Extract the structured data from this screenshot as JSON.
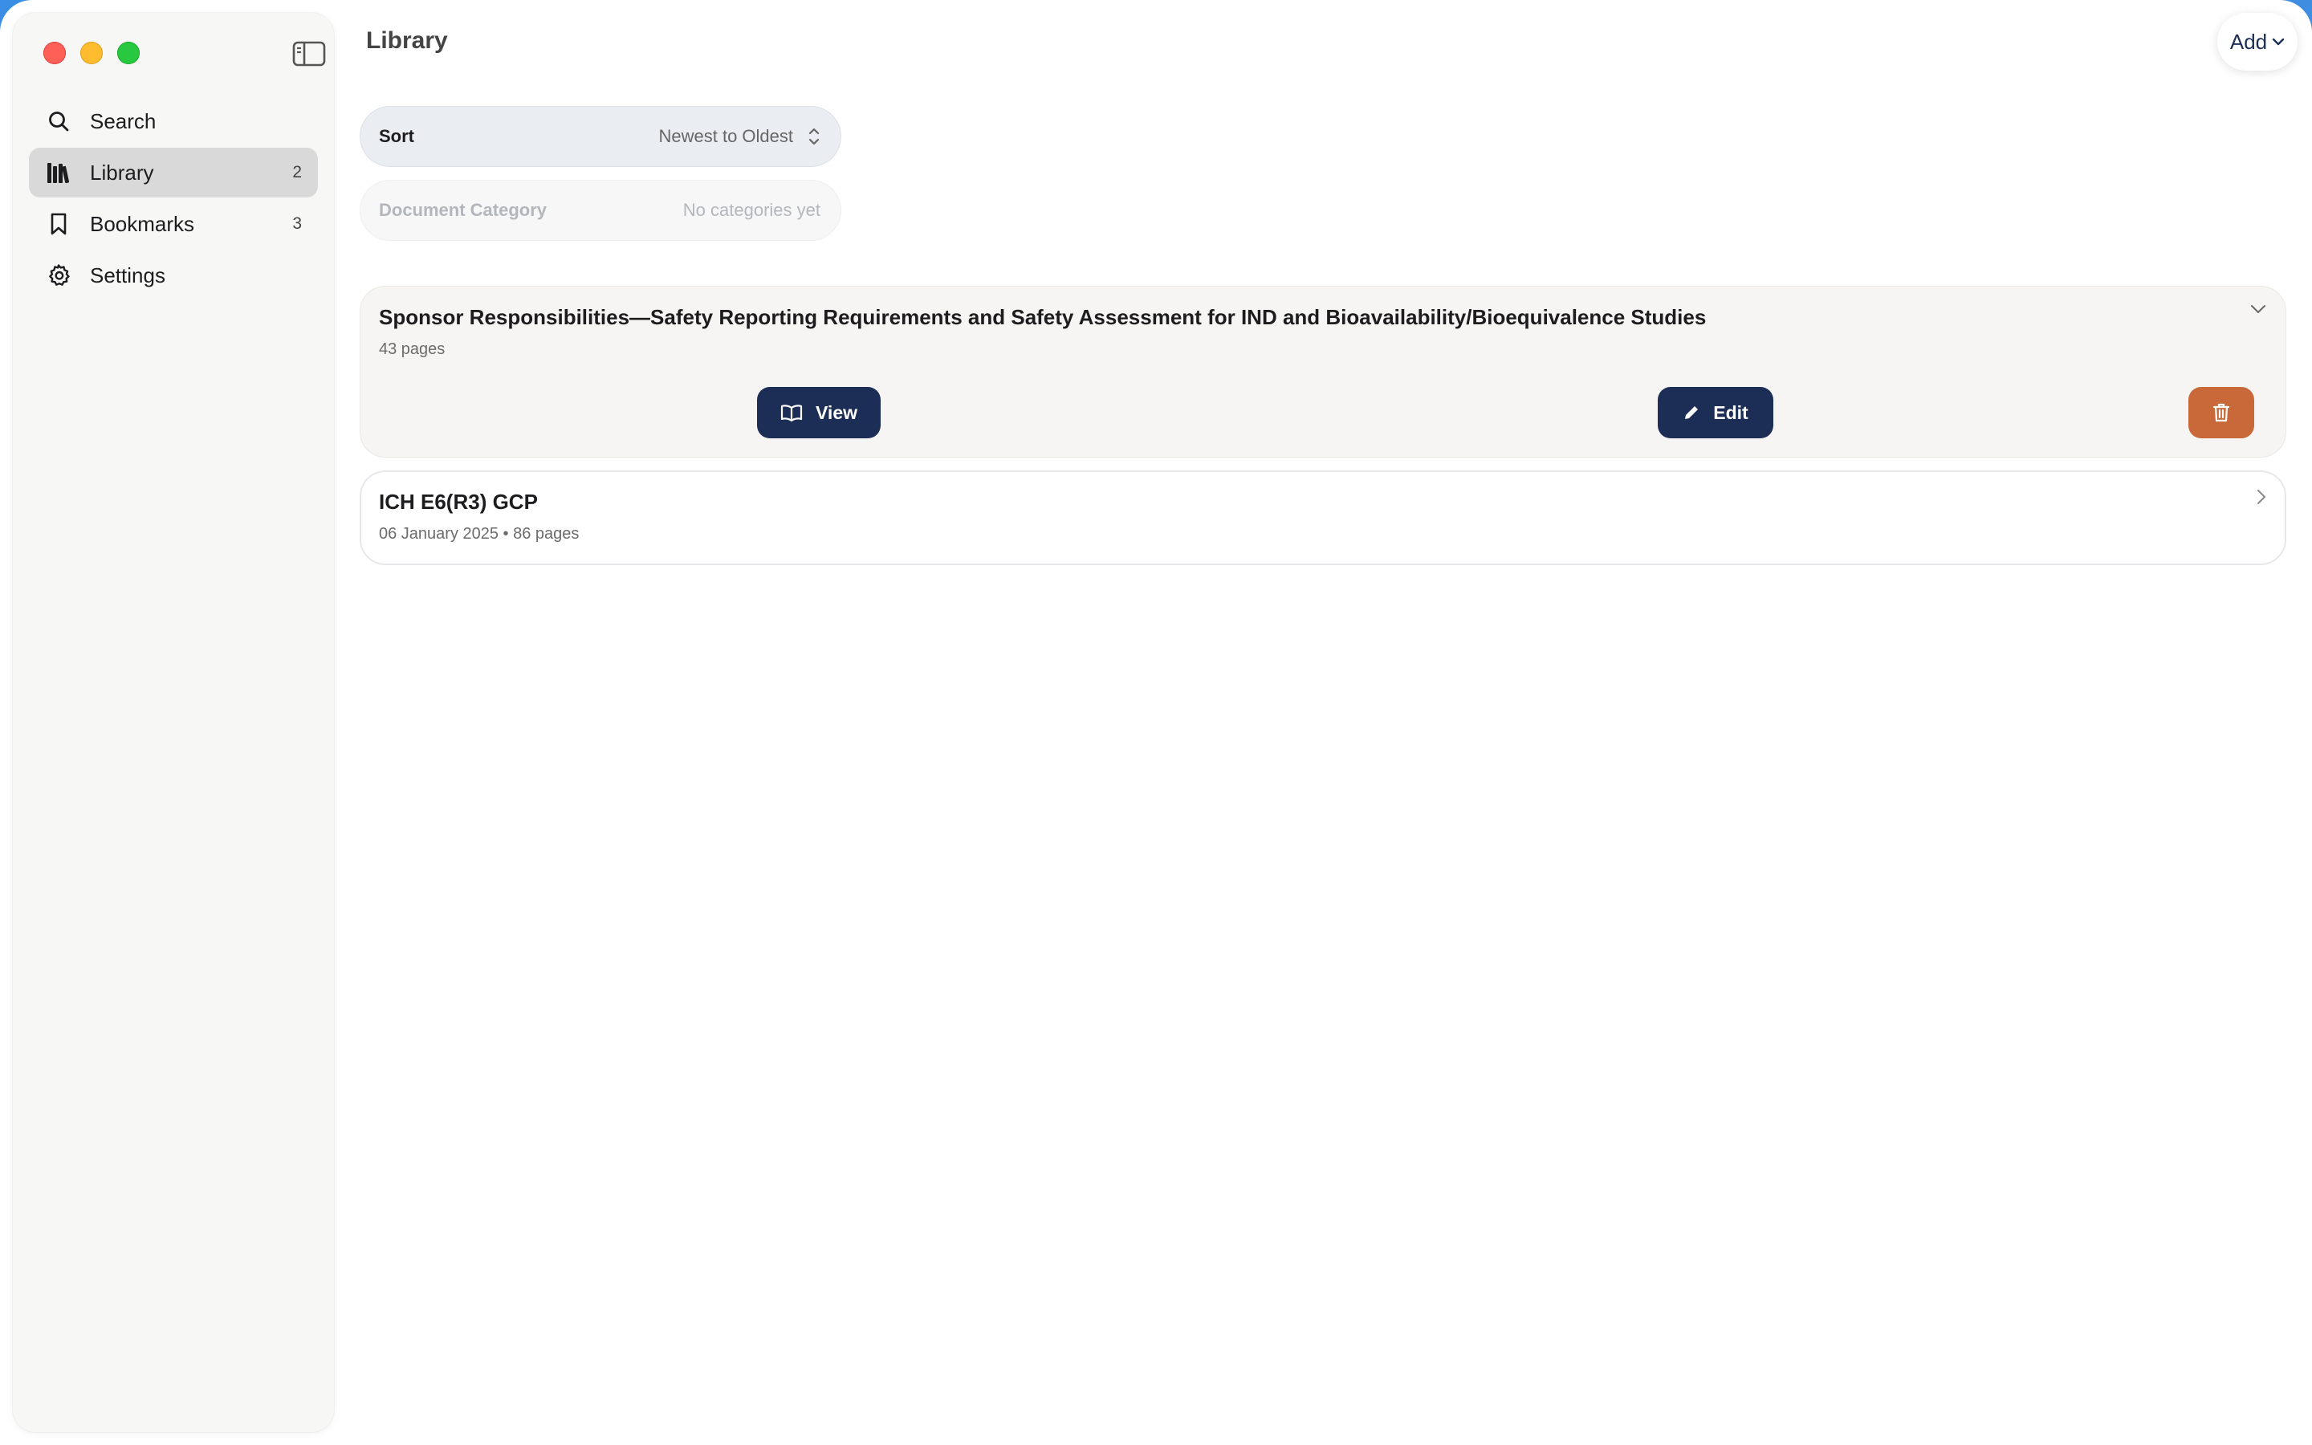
{
  "window": {
    "title": "Library"
  },
  "sidebar": {
    "items": [
      {
        "label": "Search",
        "icon": "search-icon",
        "count": ""
      },
      {
        "label": "Library",
        "icon": "library-icon",
        "count": "2",
        "active": true
      },
      {
        "label": "Bookmarks",
        "icon": "bookmark-icon",
        "count": "3"
      },
      {
        "label": "Settings",
        "icon": "gear-icon",
        "count": ""
      }
    ]
  },
  "toolbar": {
    "add_label": "Add"
  },
  "filters": {
    "sort_label": "Sort",
    "sort_value": "Newest to Oldest",
    "category_label": "Document Category",
    "category_value": "No categories yet"
  },
  "documents": [
    {
      "title": "Sponsor Responsibilities—Safety Reporting Requirements and Safety Assessment for IND and Bioavailability/Bioequivalence Studies",
      "meta": "43 pages",
      "expanded": true,
      "view_label": "View",
      "edit_label": "Edit"
    },
    {
      "title": "ICH E6(R3) GCP",
      "meta": "06 January 2025 • 86 pages",
      "expanded": false
    }
  ],
  "colors": {
    "accent": "#1c2e55",
    "danger": "#c9693a",
    "active_nav": "#d9d9d9"
  }
}
